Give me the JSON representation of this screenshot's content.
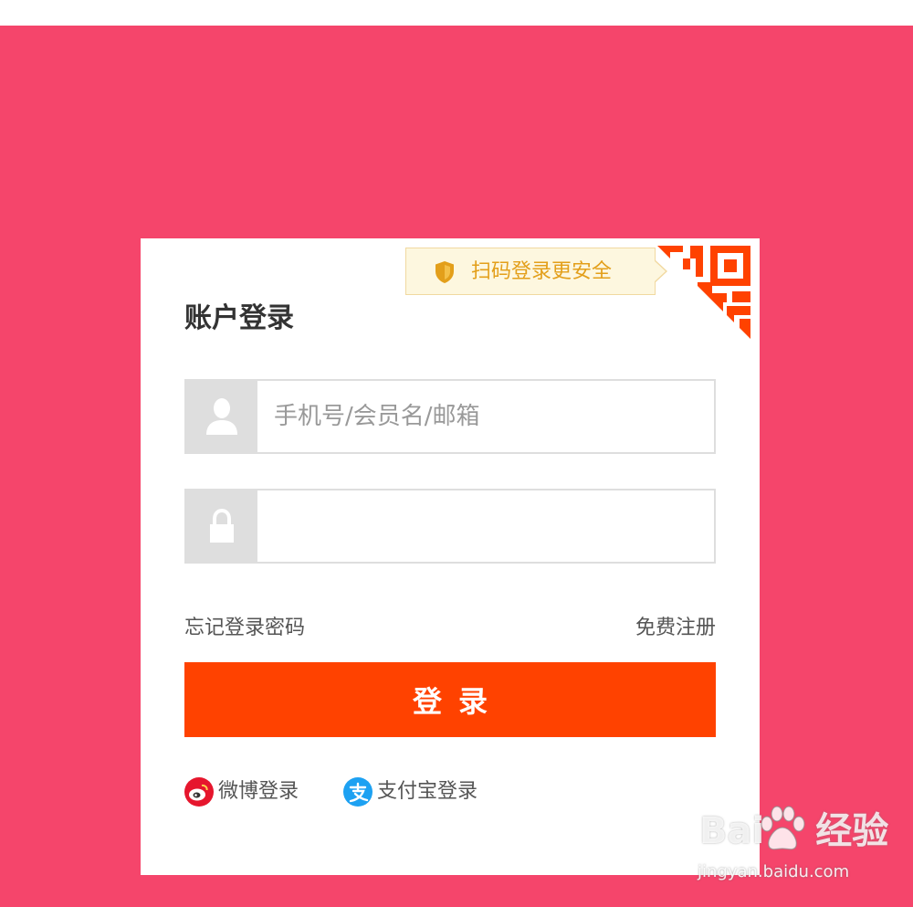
{
  "qr_tip": {
    "text": "扫码登录更安全",
    "icon": "shield-icon"
  },
  "login": {
    "title": "账户登录",
    "username_placeholder": "手机号/会员名/邮箱",
    "username_value": "",
    "password_placeholder": "",
    "password_value": "",
    "forgot_label": "忘记登录密码",
    "register_label": "免费注册",
    "submit_label": "登录"
  },
  "social": [
    {
      "label": "微博登录",
      "icon": "weibo-icon"
    },
    {
      "label": "支付宝登录",
      "icon": "alipay-icon"
    }
  ],
  "watermark": {
    "brand_left": "Bai",
    "brand_right": "经验",
    "url": "jingyan.baidu.com"
  },
  "colors": {
    "background": "#f5456b",
    "accent": "#ff4200",
    "tip_text": "#e39f1a",
    "tip_background": "#fdf7df",
    "field_border": "#dedede",
    "weibo": "#e6162d",
    "alipay": "#1da1f2"
  }
}
